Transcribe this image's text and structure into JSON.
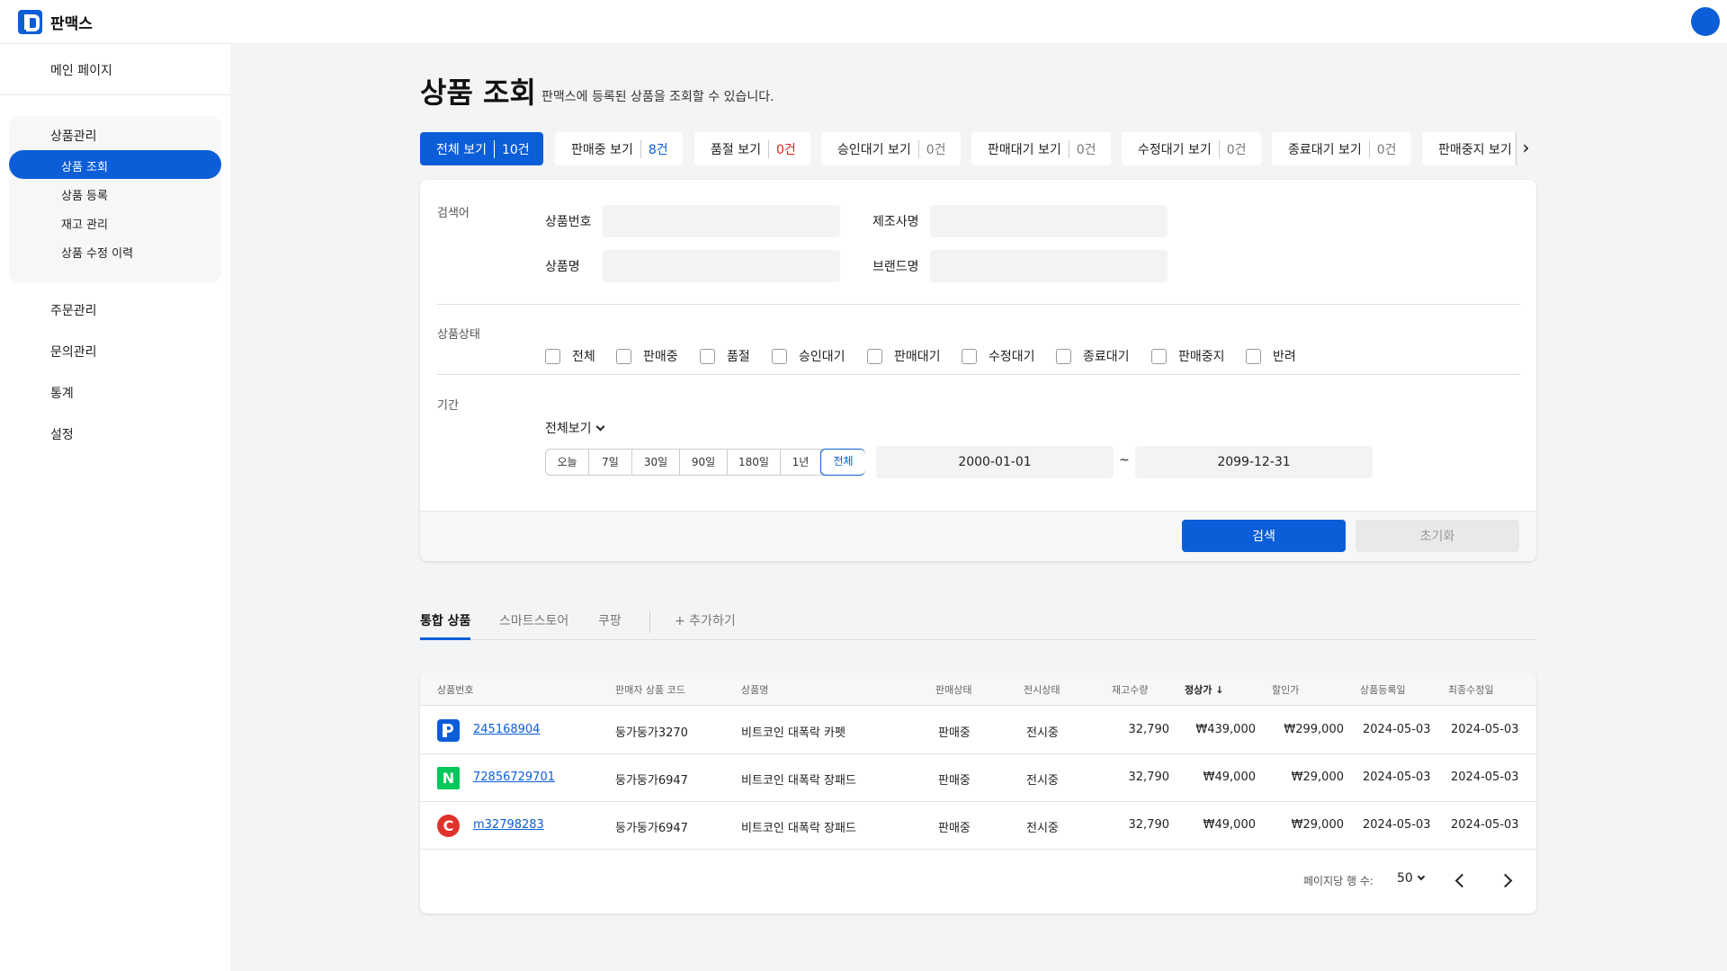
{
  "app": {
    "name": "판맥스"
  },
  "sidebar": {
    "main": "메인 페이지",
    "group_title": "상품관리",
    "sub_items": [
      "상품 조회",
      "상품 등록",
      "재고 관리",
      "상품 수정 이력"
    ],
    "items": [
      "주문관리",
      "문의관리",
      "통계",
      "설정"
    ]
  },
  "page": {
    "title": "상품 조회",
    "subtitle": "판맥스에 등록된 상품을 조회할 수 있습니다."
  },
  "chips": [
    {
      "label": "전체 보기",
      "count": "10건"
    },
    {
      "label": "판매중 보기",
      "count": "8건"
    },
    {
      "label": "품절 보기",
      "count": "0건"
    },
    {
      "label": "승인대기 보기",
      "count": "0건"
    },
    {
      "label": "판매대기 보기",
      "count": "0건"
    },
    {
      "label": "수정대기 보기",
      "count": "0건"
    },
    {
      "label": "종료대기 보기",
      "count": "0건"
    },
    {
      "label": "판매중지 보기",
      "count": ""
    }
  ],
  "search": {
    "section_keyword": "검색어",
    "product_no_label": "상품번호",
    "manufacturer_label": "제조사명",
    "product_name_label": "상품명",
    "brand_label": "브랜드명",
    "section_status": "상품상태",
    "statuses": [
      "전체",
      "판매중",
      "품절",
      "승인대기",
      "판매대기",
      "수정대기",
      "종료대기",
      "판매중지",
      "반려"
    ],
    "section_period": "기간",
    "range_select": "전체보기",
    "periods": [
      "오늘",
      "7일",
      "30일",
      "90일",
      "180일",
      "1년",
      "전체"
    ],
    "selected_period": "전체",
    "date_from": "2000-01-01",
    "date_separator": "~",
    "date_to": "2099-12-31",
    "search_button": "검색",
    "reset_button": "초기화"
  },
  "tabs": [
    "통합 상품",
    "스마트스토어",
    "쿠팡",
    "+ 추가하기"
  ],
  "table": {
    "headers": [
      "상품번호",
      "판매자 상품 코드",
      "상품명",
      "판매상태",
      "전시상태",
      "재고수량",
      "정상가 ↓",
      "할인가",
      "상품등록일",
      "최종수정일"
    ],
    "rows": [
      {
        "channel": "P",
        "no": "245168904",
        "code": "둥가둥가3270",
        "name": "비트코인 대폭락 카펫",
        "sale": "판매중",
        "display": "전시중",
        "stock": "32,790",
        "price": "₩439,000",
        "discount": "₩299,000",
        "created": "2024-05-03",
        "updated": "2024-05-03"
      },
      {
        "channel": "N",
        "no": "72856729701",
        "code": "둥가둥가6947",
        "name": "비트코인 대폭락 장패드",
        "sale": "판매중",
        "display": "전시중",
        "stock": "32,790",
        "price": "₩49,000",
        "discount": "₩29,000",
        "created": "2024-05-03",
        "updated": "2024-05-03"
      },
      {
        "channel": "C",
        "no": "m32798283",
        "code": "둥가둥가6947",
        "name": "비트코인 대폭락 장패드",
        "sale": "판매중",
        "display": "전시중",
        "stock": "32,790",
        "price": "₩49,000",
        "discount": "₩29,000",
        "created": "2024-05-03",
        "updated": "2024-05-03"
      }
    ],
    "rows_per_page_label": "페이지당 행 수:",
    "rows_per_page": "50"
  },
  "colors": {
    "primary": "#0b5ed7",
    "naver": "#03c75a",
    "coupang": "#e0312a",
    "danger": "#e02020"
  }
}
